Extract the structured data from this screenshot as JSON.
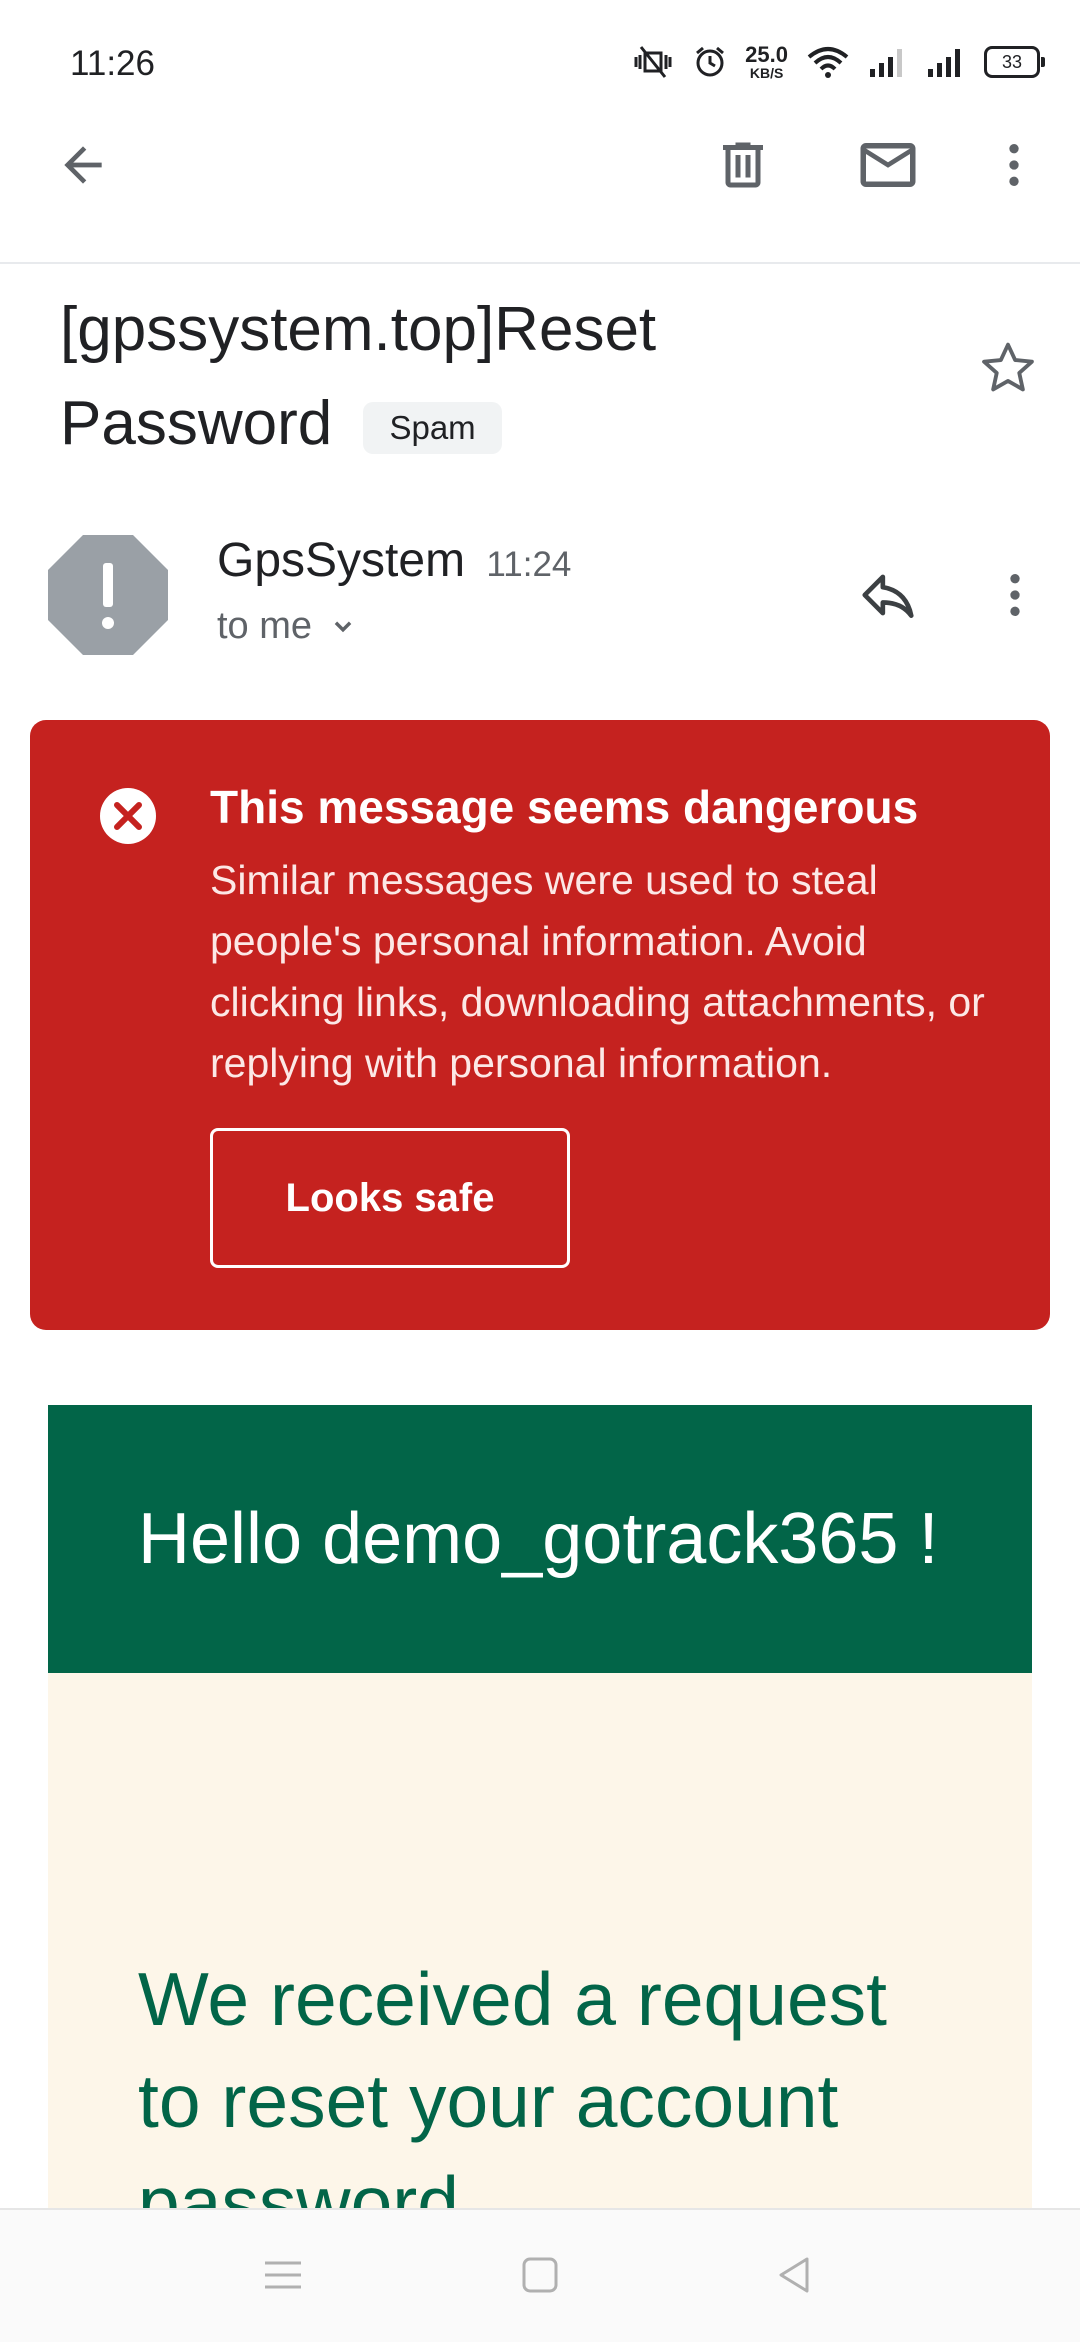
{
  "status_bar": {
    "time": "11:26",
    "net_speed_value": "25.0",
    "net_speed_unit": "KB/S",
    "battery": "33",
    "icons": [
      "vibrate-off-icon",
      "alarm-icon",
      "wifi-icon",
      "signal-icon",
      "signal-icon",
      "battery-icon"
    ]
  },
  "toolbar": {
    "back_icon": "arrow-left-icon",
    "delete_icon": "trash-icon",
    "mark_unread_icon": "mail-icon",
    "more_icon": "more-vert-icon"
  },
  "email": {
    "subject": "[gpssystem.top]Reset Password",
    "label": "Spam",
    "sender": "GpsSystem",
    "time": "11:24",
    "recipient": "to me"
  },
  "warning": {
    "title": "This message seems dangerous",
    "body": "Similar messages were used to steal people's personal information. Avoid clicking links, downloading attachments, or replying with personal information.",
    "button": "Looks safe",
    "color": "#c5221f"
  },
  "content": {
    "greeting": "Hello demo_gotrack365 !",
    "heading": "We received a request to reset your account password",
    "header_color": "#026548",
    "body_bg": "#fdf6e9"
  },
  "navbar": {
    "icons": [
      "menu-icon",
      "home-square-icon",
      "back-triangle-icon"
    ]
  }
}
